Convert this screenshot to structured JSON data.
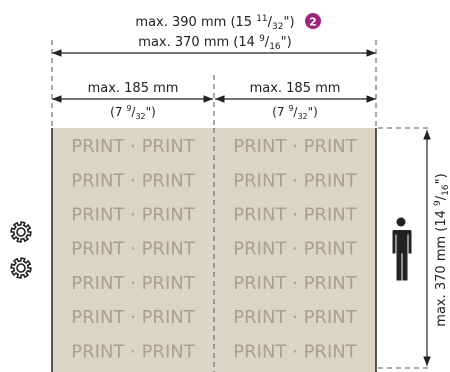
{
  "dimensions": {
    "overall_width": {
      "value": "max. 390 mm",
      "inch_whole": "15",
      "inch_num": "11",
      "inch_den": "32",
      "badge": "2"
    },
    "print_width": {
      "value": "max. 370 mm",
      "inch_whole": "14",
      "inch_num": "9",
      "inch_den": "16"
    },
    "column_left": {
      "value": "max. 185 mm",
      "inch_whole": "7",
      "inch_num": "9",
      "inch_den": "32"
    },
    "column_right": {
      "value": "max. 185 mm",
      "inch_whole": "7",
      "inch_num": "9",
      "inch_den": "32"
    },
    "height": {
      "value": "max. 370 mm",
      "inch_whole": "14",
      "inch_num": "9",
      "inch_den": "16"
    }
  },
  "print_area": {
    "cell_text": "PRINT · PRINT",
    "rows": 7,
    "columns": 2
  },
  "icons": {
    "gears": [
      "gear-icon",
      "gear-icon"
    ],
    "person": "person-icon"
  },
  "colors": {
    "print_bg": "#dad6c6",
    "print_text": "#a8a18b",
    "line": "#222222",
    "dashed": "#555555",
    "badge": "#a3227d",
    "icon": "#222222"
  }
}
